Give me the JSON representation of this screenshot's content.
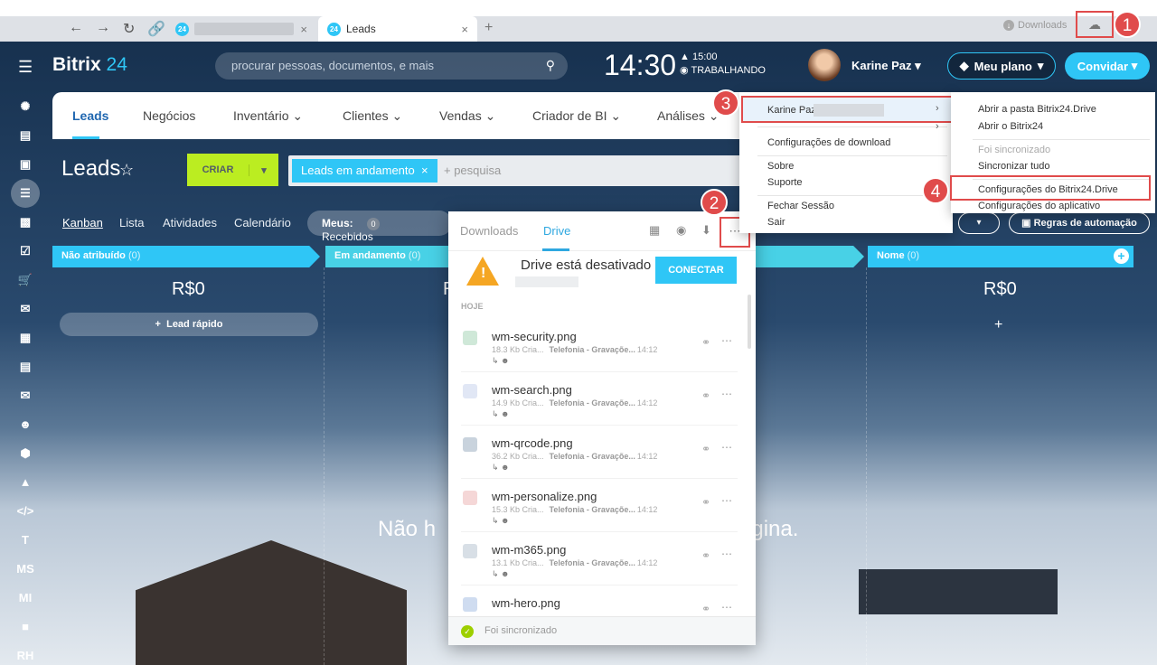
{
  "browser": {
    "tab_active": "Leads",
    "downloads_label": "Downloads"
  },
  "header": {
    "logo_name": "Bitrix",
    "logo_num": "24",
    "search_placeholder": "procurar pessoas, documentos, e mais",
    "clock": "14:30",
    "work_time": "15:00",
    "work_status": "TRABALHANDO",
    "user_name": "Karine Paz",
    "plan_label": "Meu plano",
    "invite_label": "Convidar"
  },
  "sidebar": [
    "T",
    "MS",
    "MI",
    "RH"
  ],
  "nav": {
    "tabs": [
      "Leads",
      "Negócios",
      "Inventário",
      "Clientes",
      "Vendas",
      "Criador de BI",
      "Análises"
    ]
  },
  "page": {
    "title": "Leads",
    "create_label": "CRIAR",
    "filter_chip": "Leads em andamento",
    "filter_search": "+ pesquisa",
    "views": [
      "Kanban",
      "Lista",
      "Atividades",
      "Calendário"
    ],
    "meus_label": "Meus:",
    "meus_count": "0",
    "meus_received": "Recebidos",
    "automation_label": "Regras de automação"
  },
  "kanban": {
    "columns": [
      {
        "name": "Não atribuído",
        "count": "(0)",
        "amount": "R$0",
        "color": "#2fc6f6"
      },
      {
        "name": "Em andamento",
        "count": "(0)",
        "amount": "R$0",
        "color": "#2fc6f6"
      },
      {
        "name": "Nome",
        "count": "(0)",
        "amount": "R$0",
        "color": "#2fc6f6"
      }
    ],
    "quick_lead": "Lead rápido",
    "empty_left": "Não h",
    "empty_right": "ágina."
  },
  "drive_panel": {
    "tab_downloads": "Downloads",
    "tab_drive": "Drive",
    "status": "Drive está desativado",
    "connect_label": "CONECTAR",
    "section": "HOJE",
    "files": [
      {
        "name": "wm-security.png",
        "size": "18.3 Kb Cria...",
        "source": "Telefonia - Gravaçõe...",
        "time": "14:12"
      },
      {
        "name": "wm-search.png",
        "size": "14.9 Kb Cria...",
        "source": "Telefonia - Gravaçõe...",
        "time": "14:12"
      },
      {
        "name": "wm-qrcode.png",
        "size": "36.2 Kb Cria...",
        "source": "Telefonia - Gravaçõe...",
        "time": "14:12"
      },
      {
        "name": "wm-personalize.png",
        "size": "15.3 Kb Cria...",
        "source": "Telefonia - Gravaçõe...",
        "time": "14:12"
      },
      {
        "name": "wm-m365.png",
        "size": "13.1 Kb Cria...",
        "source": "Telefonia - Gravaçõe...",
        "time": "14:12"
      },
      {
        "name": "wm-hero.png",
        "size": "",
        "source": "",
        "time": ""
      }
    ],
    "footer": "Foi sincronizado"
  },
  "context_menu": {
    "user": "Karine Paz",
    "download_settings": "Configurações de download",
    "about": "Sobre",
    "support": "Suporte",
    "logout": "Fechar Sessão",
    "exit": "Sair"
  },
  "submenu": {
    "open_folder": "Abrir a pasta Bitrix24.Drive",
    "open_bitrix": "Abrir o Bitrix24",
    "synced": "Foi sincronizado",
    "sync_all": "Sincronizar tudo",
    "drive_settings": "Configurações do Bitrix24.Drive",
    "app_settings": "Configurações do aplicativo"
  },
  "steps": [
    "1",
    "2",
    "3",
    "4"
  ]
}
